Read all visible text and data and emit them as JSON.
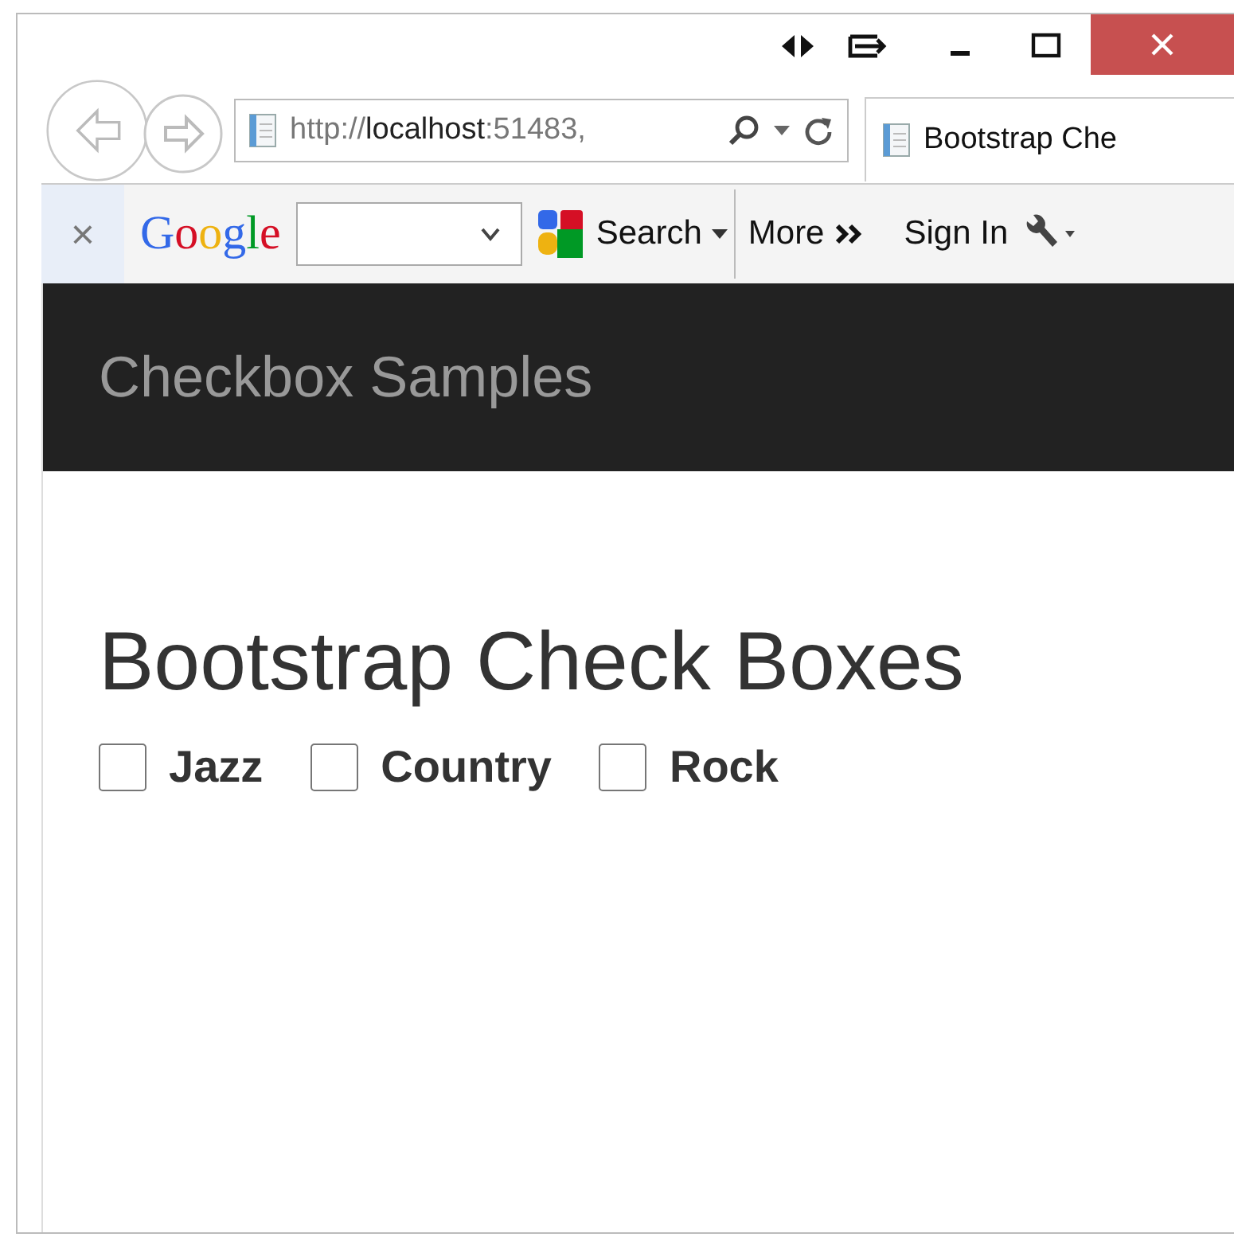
{
  "browser": {
    "address": "http://**localhost**:51483,",
    "tab_title": "Bootstrap Che"
  },
  "toolbar": {
    "close": "×",
    "logo": "Google",
    "search_button": "Search",
    "more": "More",
    "sign_in": "Sign In"
  },
  "navbar": {
    "brand": "Checkbox Samples"
  },
  "page": {
    "heading": "Bootstrap Check Boxes",
    "checkboxes": [
      {
        "label": "Jazz",
        "checked": false
      },
      {
        "label": "Country",
        "checked": false
      },
      {
        "label": "Rock",
        "checked": false
      }
    ]
  }
}
